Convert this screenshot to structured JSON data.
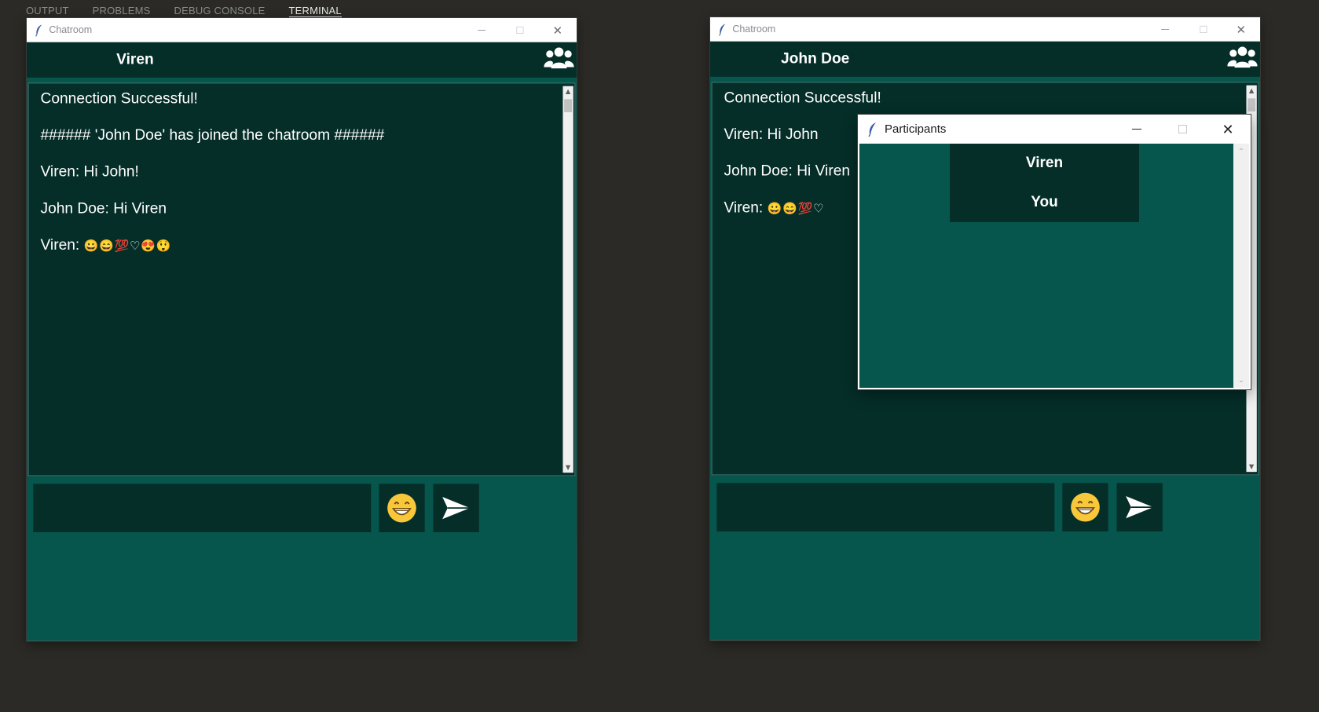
{
  "panel_tabs": [
    "OUTPUT",
    "PROBLEMS",
    "DEBUG CONSOLE",
    "TERMINAL"
  ],
  "windows": [
    {
      "title": "Chatroom",
      "user_name": "Viren",
      "messages": [
        "Connection Successful!",
        "###### 'John Doe' has joined the chatroom ######",
        "Viren: Hi John!",
        "John Doe: Hi Viren"
      ],
      "emoji_msg_prefix": "Viren:",
      "emoji_msg_emojis": "😀😄💯♡😍😲",
      "input_value": "",
      "emoji_button": "😁",
      "send_icon": "send-arrow-icon"
    },
    {
      "title": "Chatroom",
      "user_name": "John Doe",
      "messages": [
        "Connection Successful!",
        "Viren: Hi John",
        "John Doe: Hi Viren"
      ],
      "emoji_msg_prefix": "Viren:",
      "emoji_msg_emojis": "😀😄💯♡",
      "input_value": "",
      "emoji_button": "😁",
      "send_icon": "send-arrow-icon"
    }
  ],
  "participants_popup": {
    "title": "Participants",
    "items": [
      "Viren",
      "You"
    ]
  },
  "colors": {
    "dark_teal": "#052e29",
    "teal": "#06564d",
    "background": "#2b2a26"
  }
}
